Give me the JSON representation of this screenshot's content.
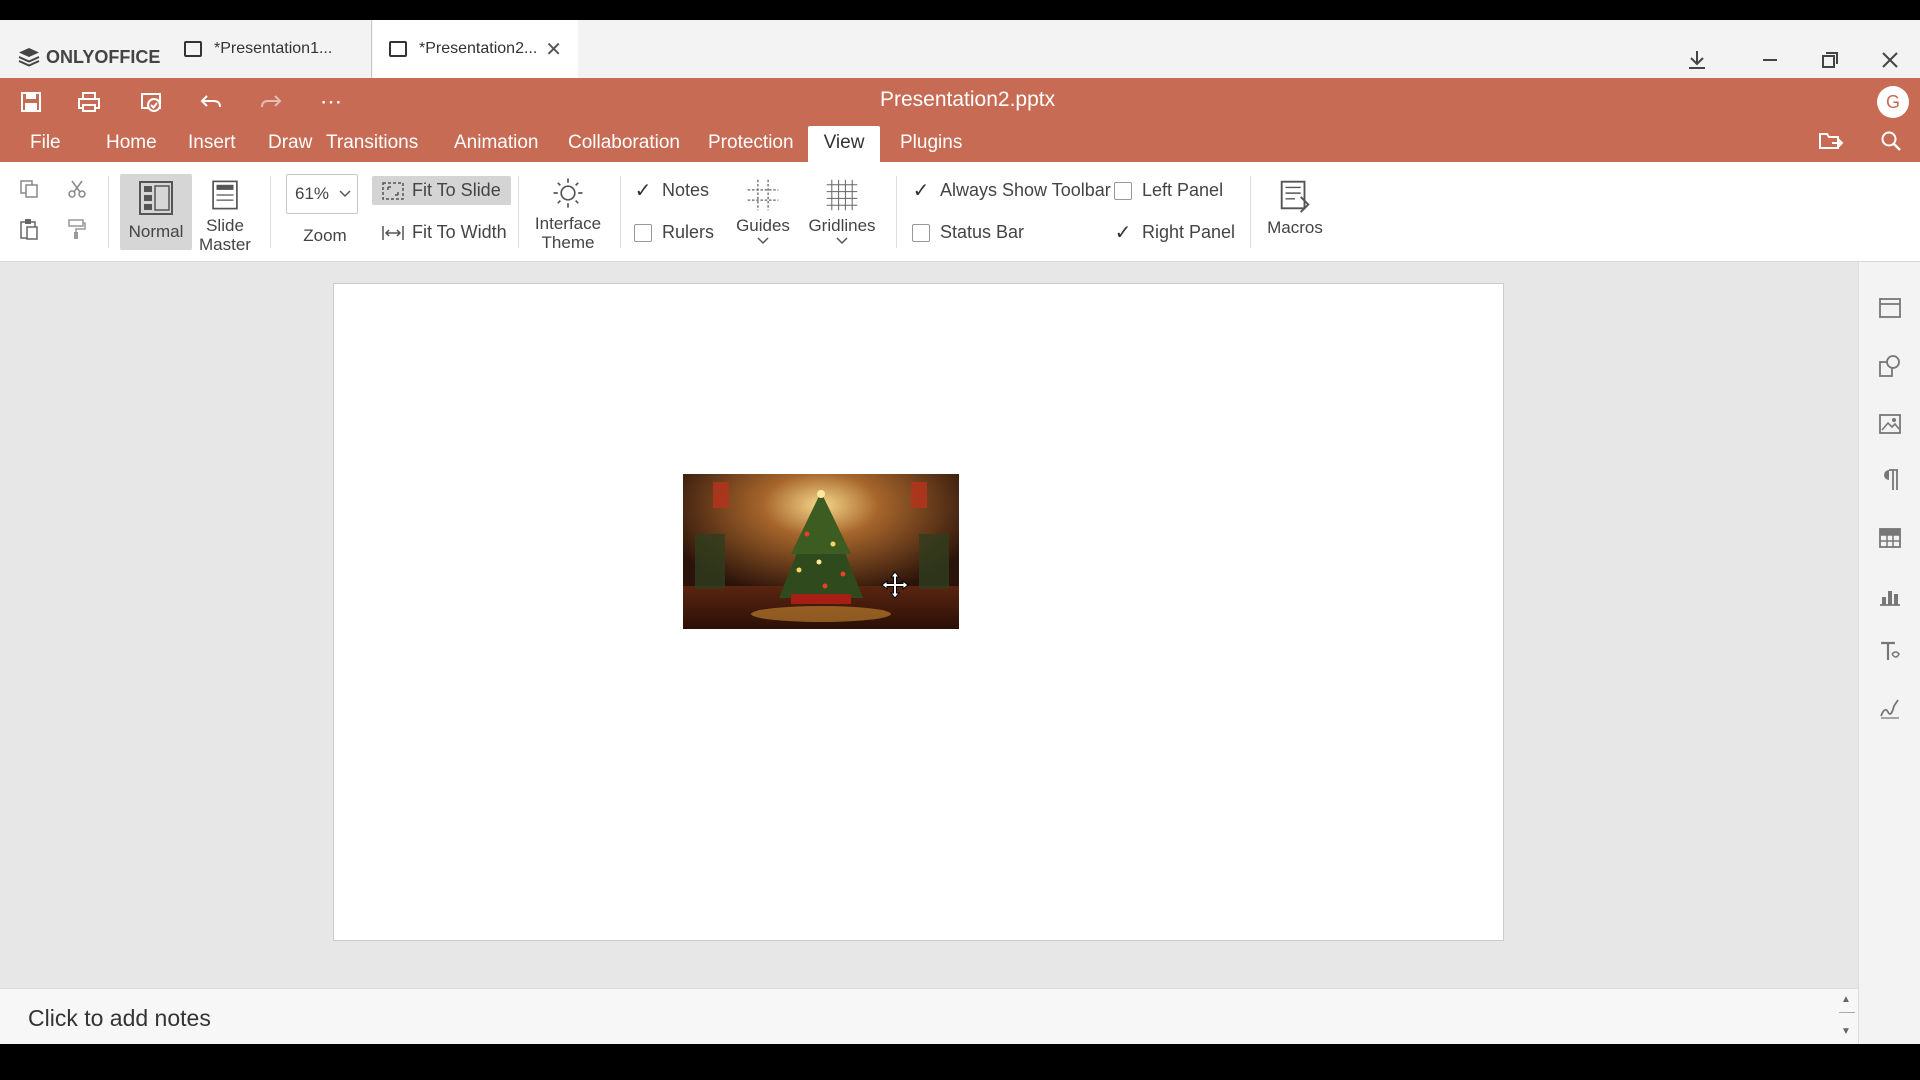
{
  "brand": {
    "name": "ONLYOFFICE"
  },
  "tabs": [
    {
      "label": "*Presentation1..."
    },
    {
      "label": "*Presentation2..."
    }
  ],
  "window": {
    "download_icon": "download-icon",
    "minimize_icon": "minimize-icon",
    "maximize_icon": "maximize-icon",
    "close_icon": "close-icon"
  },
  "header": {
    "doc_title": "Presentation2.pptx",
    "avatar_initial": "G",
    "menu": [
      "File",
      "Home",
      "Insert",
      "Draw",
      "Transitions",
      "Animation",
      "Collaboration",
      "Protection",
      "View",
      "Plugins"
    ],
    "active_menu": "View"
  },
  "toolbar": {
    "normal_label": "Normal",
    "slide_master_label": [
      "Slide",
      "Master"
    ],
    "zoom_value": "61%",
    "zoom_label": "Zoom",
    "fit_to_slide": "Fit To Slide",
    "fit_to_width": "Fit To Width",
    "interface_theme": [
      "Interface",
      "Theme"
    ],
    "notes": {
      "label": "Notes",
      "checked": true
    },
    "rulers": {
      "label": "Rulers",
      "checked": false
    },
    "guides_label": "Guides",
    "gridlines_label": "Gridlines",
    "always_show_toolbar": {
      "label": "Always Show Toolbar",
      "checked": true
    },
    "status_bar": {
      "label": "Status Bar",
      "checked": false
    },
    "left_panel": {
      "label": "Left Panel",
      "checked": false
    },
    "right_panel": {
      "label": "Right Panel",
      "checked": true
    },
    "macros_label": "Macros"
  },
  "notes": {
    "placeholder": "Click to add notes"
  },
  "colors": {
    "accent": "#c76b54",
    "workspace": "#e7e7e7",
    "toolbar": "#ffffff"
  }
}
